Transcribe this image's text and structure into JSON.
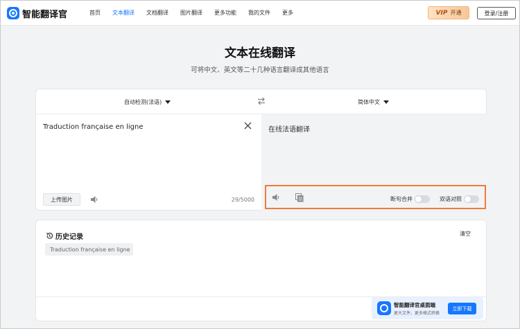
{
  "header": {
    "brand": "智能翻译官",
    "nav": [
      "首页",
      "文本翻译",
      "文档翻译",
      "图片翻译",
      "更多功能",
      "我的文件",
      "更多"
    ],
    "active_nav": "文本翻译",
    "vip_badge": "VIP",
    "vip_label": "开通",
    "login_label": "登录/注册"
  },
  "hero": {
    "title": "文本在线翻译",
    "subtitle": "可将中文、英文等二十几种语言翻译成其他语言"
  },
  "translator": {
    "source_lang": "自动检测(法语)",
    "target_lang": "简体中文",
    "source_text": "Traduction française en ligne",
    "target_text": "在线法语翻译",
    "upload_label": "上传图片",
    "char_count": "29/5000",
    "toggle_merge_label": "断句合并",
    "toggle_bilingual_label": "双语对照",
    "toggle_merge_on": false,
    "toggle_bilingual_on": false
  },
  "history": {
    "title": "历史记录",
    "clear_label": "清空",
    "items": [
      "Traduction française en ligne"
    ]
  },
  "promo": {
    "title": "智能翻译官桌面端",
    "subtitle": "更大文件、更多格式转换",
    "button": "立即下载"
  },
  "colors": {
    "accent": "#1677ff",
    "highlight_border": "#f07a3a",
    "vip_gold": "#f7c79a"
  },
  "icons": [
    "app-logo-icon",
    "swap-icon",
    "close-icon",
    "speaker-icon",
    "copy-icon",
    "history-icon",
    "caret-down-icon"
  ]
}
